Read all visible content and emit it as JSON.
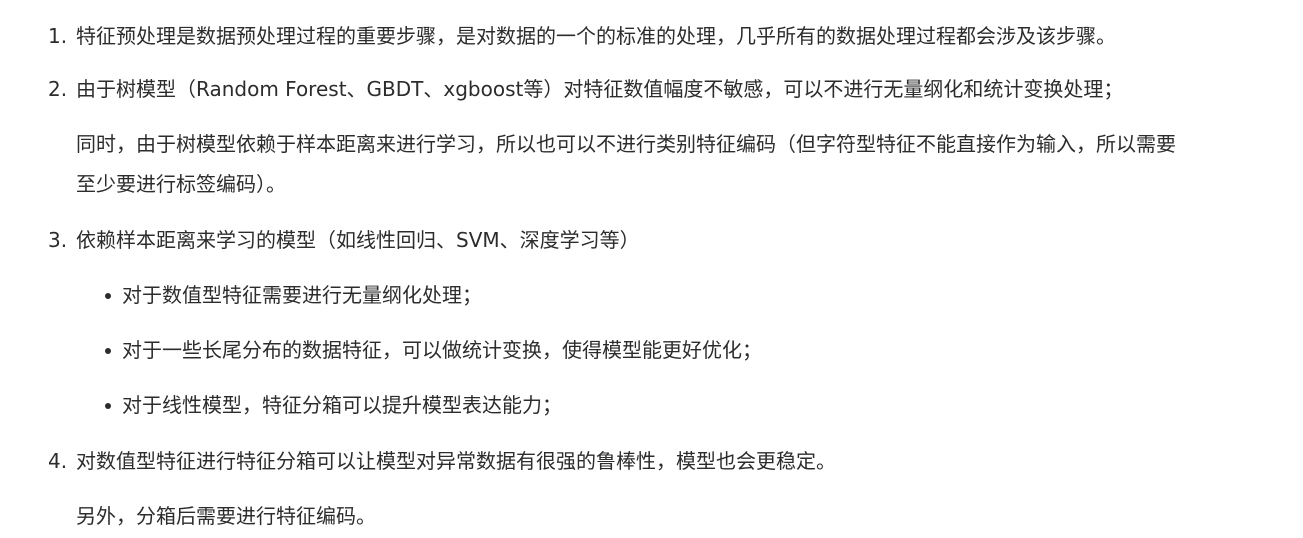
{
  "list": {
    "item1": {
      "number": "1.",
      "text": "特征预处理是数据预处理过程的重要步骤，是对数据的一个的标准的处理，几乎所有的数据处理过程都会涉及该步骤。"
    },
    "item2": {
      "number": "2.",
      "text": "由于树模型（Random Forest、GBDT、xgboost等）对特征数值幅度不敏感，可以不进行无量纲化和统计变换处理；",
      "para2_line1": "同时，由于树模型依赖于样本距离来进行学习，所以也可以不进行类别特征编码（但字符型特征不能直接作为输入，所以需要",
      "para2_line2": "至少要进行标签编码）。"
    },
    "item3": {
      "number": "3.",
      "text": "依赖样本距离来学习的模型（如线性回归、SVM、深度学习等）",
      "bullets": [
        "对于数值型特征需要进行无量纲化处理；",
        "对于一些长尾分布的数据特征，可以做统计变换，使得模型能更好优化；",
        "对于线性模型，特征分箱可以提升模型表达能力；"
      ]
    },
    "item4": {
      "number": "4.",
      "text": "对数值型特征进行特征分箱可以让模型对异常数据有很强的鲁棒性，模型也会更稳定。",
      "para2": "另外，分箱后需要进行特征编码。"
    }
  }
}
